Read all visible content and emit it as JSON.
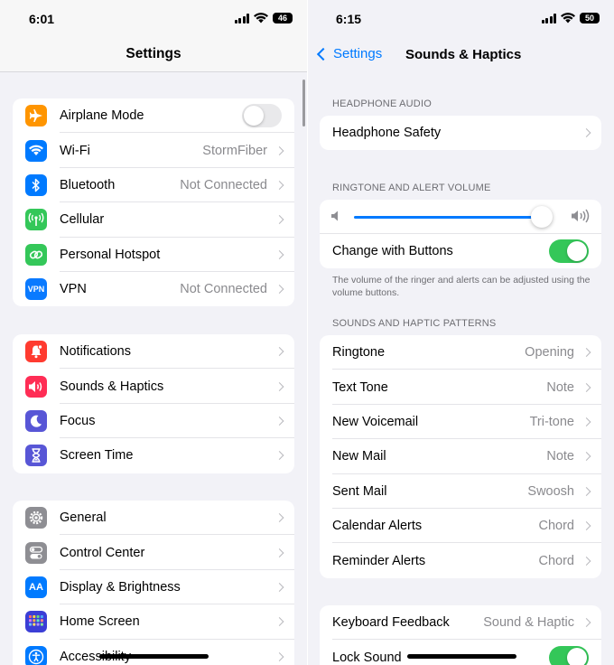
{
  "left": {
    "status": {
      "time": "6:01",
      "battery": "46"
    },
    "title": "Settings",
    "groups": [
      [
        {
          "label": "Airplane Mode",
          "icon": "airplane-icon",
          "color": "#ff9500",
          "toggle": false
        },
        {
          "label": "Wi-Fi",
          "value": "StormFiber",
          "icon": "wifi-icon",
          "color": "#007aff"
        },
        {
          "label": "Bluetooth",
          "value": "Not Connected",
          "icon": "bluetooth-icon",
          "color": "#007aff"
        },
        {
          "label": "Cellular",
          "icon": "antenna-icon",
          "color": "#34c759"
        },
        {
          "label": "Personal Hotspot",
          "icon": "link-icon",
          "color": "#34c759"
        },
        {
          "label": "VPN",
          "value": "Not Connected",
          "icon": "vpn-icon",
          "icon_text": "VPN",
          "color": "#0a7aff"
        }
      ],
      [
        {
          "label": "Notifications",
          "icon": "bell-icon",
          "color": "#ff3b30"
        },
        {
          "label": "Sounds & Haptics",
          "icon": "speaker-icon",
          "color": "#ff2d55"
        },
        {
          "label": "Focus",
          "icon": "moon-icon",
          "color": "#5856d6"
        },
        {
          "label": "Screen Time",
          "icon": "hourglass-icon",
          "color": "#5856d6"
        }
      ],
      [
        {
          "label": "General",
          "icon": "gear-icon",
          "color": "#8e8e93"
        },
        {
          "label": "Control Center",
          "icon": "switches-icon",
          "color": "#8e8e93"
        },
        {
          "label": "Display & Brightness",
          "icon": "text-size-icon",
          "icon_text": "AA",
          "color": "#007aff"
        },
        {
          "label": "Home Screen",
          "icon": "app-grid-icon",
          "color": "#3b3ed6"
        },
        {
          "label": "Accessibility",
          "icon": "accessibility-icon",
          "color": "#007aff"
        }
      ]
    ]
  },
  "right": {
    "status": {
      "time": "6:15",
      "battery": "50"
    },
    "back_label": "Settings",
    "title": "Sounds & Haptics",
    "headphone_header": "HEADPHONE AUDIO",
    "headphone_safety": "Headphone Safety",
    "ringtone_header": "RINGTONE AND ALERT VOLUME",
    "volume_level": 0.96,
    "change_with_buttons": "Change with Buttons",
    "change_with_buttons_on": true,
    "volume_footer": "The volume of the ringer and alerts can be adjusted using the volume buttons.",
    "patterns_header": "SOUNDS AND HAPTIC PATTERNS",
    "patterns": [
      {
        "label": "Ringtone",
        "value": "Opening"
      },
      {
        "label": "Text Tone",
        "value": "Note"
      },
      {
        "label": "New Voicemail",
        "value": "Tri-tone"
      },
      {
        "label": "New Mail",
        "value": "Note"
      },
      {
        "label": "Sent Mail",
        "value": "Swoosh"
      },
      {
        "label": "Calendar Alerts",
        "value": "Chord"
      },
      {
        "label": "Reminder Alerts",
        "value": "Chord"
      }
    ],
    "keyboard_feedback": {
      "label": "Keyboard Feedback",
      "value": "Sound & Haptic"
    },
    "lock_sound": {
      "label": "Lock Sound",
      "on": true
    }
  },
  "colors": {
    "accent": "#007aff",
    "toggle_on": "#34c759",
    "background": "#f2f2f7"
  }
}
